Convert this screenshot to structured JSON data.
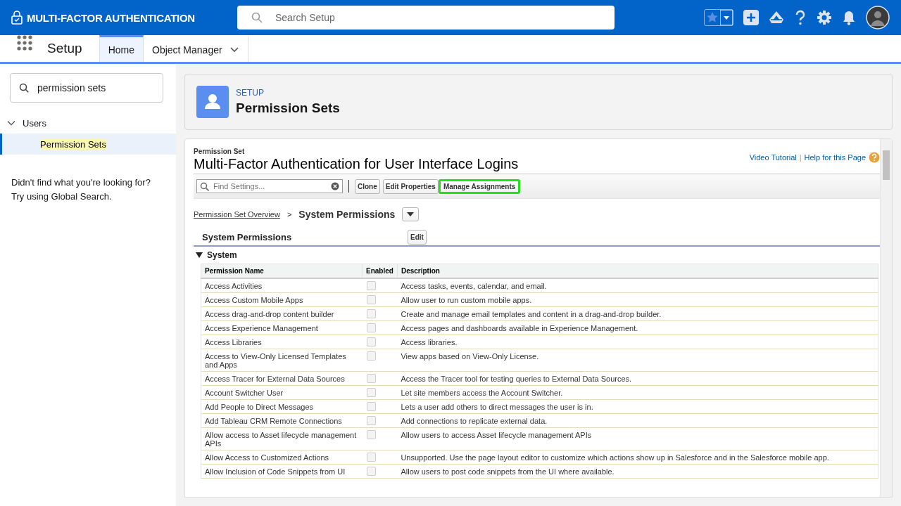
{
  "header": {
    "app_title": "MULTI-FACTOR AUTHENTICATION",
    "search": {
      "placeholder": "Search Setup"
    }
  },
  "nav": {
    "app_name": "Setup",
    "tabs": [
      {
        "label": "Home",
        "selected": true,
        "has_menu": false
      },
      {
        "label": "Object Manager",
        "selected": false,
        "has_menu": true
      }
    ]
  },
  "sidebar": {
    "search": {
      "value": "permission sets"
    },
    "tree": [
      {
        "label": "Users",
        "expanded": true,
        "children": [
          {
            "label": "Permission Sets",
            "selected": true
          }
        ]
      }
    ],
    "help_lines": [
      "Didn't find what you're looking for?",
      "Try using Global Search."
    ]
  },
  "page_header": {
    "eyebrow": "SETUP",
    "title": "Permission Sets"
  },
  "detail": {
    "record_type": "Permission Set",
    "title": "Multi-Factor Authentication for User Interface Logins",
    "links": [
      "Video Tutorial",
      "Help for this Page"
    ],
    "link_separator": "|",
    "find": {
      "placeholder": "Find Settings..."
    },
    "buttons": [
      {
        "label": "Clone",
        "highlighted": false
      },
      {
        "label": "Edit Properties",
        "highlighted": false
      },
      {
        "label": "Manage Assignments",
        "highlighted": true
      }
    ],
    "breadcrumb": {
      "link": "Permission Set Overview",
      "separator": ">",
      "current": "System Permissions"
    },
    "section": {
      "title": "System Permissions",
      "button": "Edit"
    },
    "group": {
      "title": "System",
      "expanded": true
    },
    "table": {
      "columns": [
        "Permission Name",
        "Enabled",
        "Description"
      ],
      "rows": [
        {
          "name": "Access Activities",
          "enabled": false,
          "description": "Access tasks, events, calendar, and email."
        },
        {
          "name": "Access Custom Mobile Apps",
          "enabled": false,
          "description": "Allow user to run custom mobile apps."
        },
        {
          "name": "Access drag-and-drop content builder",
          "enabled": false,
          "description": "Create and manage email templates and content in a drag-and-drop builder."
        },
        {
          "name": "Access Experience Management",
          "enabled": false,
          "description": "Access pages and dashboards available in Experience Management."
        },
        {
          "name": "Access Libraries",
          "enabled": false,
          "description": "Access libraries."
        },
        {
          "name": "Access to View-Only Licensed Templates and Apps",
          "enabled": false,
          "description": "View apps based on View-Only License."
        },
        {
          "name": "Access Tracer for External Data Sources",
          "enabled": false,
          "description": "Access the Tracer tool for testing queries to External Data Sources."
        },
        {
          "name": "Account Switcher User",
          "enabled": false,
          "description": "Let site members access the Account Switcher."
        },
        {
          "name": "Add People to Direct Messages",
          "enabled": false,
          "description": "Lets a user add others to direct messages the user is in."
        },
        {
          "name": "Add Tableau CRM Remote Connections",
          "enabled": false,
          "description": "Add connections to replicate external data."
        },
        {
          "name": "Allow access to Asset lifecycle management APIs",
          "enabled": false,
          "description": "Allow users to access Asset lifecycle management APIs"
        },
        {
          "name": "Allow Access to Customized Actions",
          "enabled": false,
          "description": "Unsupported. Use the page layout editor to customize which actions show up in Salesforce and in the Salesforce mobile app."
        },
        {
          "name": "Allow Inclusion of Code Snippets from UI",
          "enabled": false,
          "description": "Allow users to post code snippets from the UI where available."
        }
      ]
    }
  }
}
